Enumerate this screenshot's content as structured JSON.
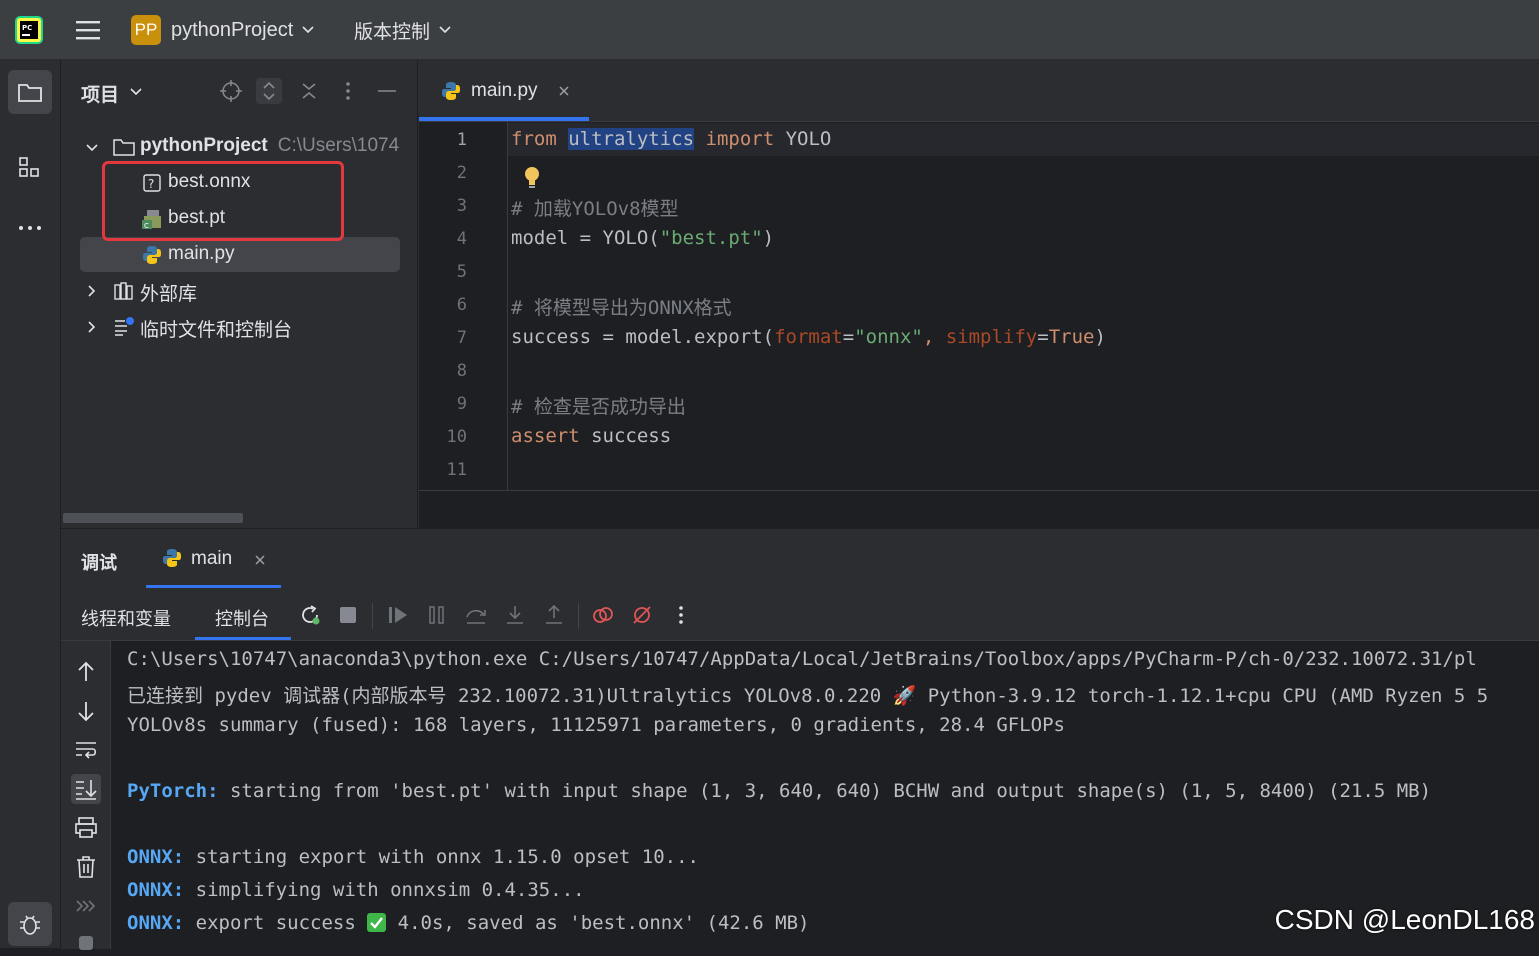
{
  "titlebar": {
    "project_badge": "PP",
    "project_name": "pythonProject",
    "vcs_label": "版本控制"
  },
  "project_panel": {
    "title": "项目",
    "tree": {
      "root_name": "pythonProject",
      "root_path": "C:\\Users\\1074",
      "files": [
        "best.onnx",
        "best.pt",
        "main.py"
      ],
      "external_libraries": "外部库",
      "scratches": "临时文件和控制台"
    }
  },
  "editor": {
    "tab_label": "main.py",
    "line_numbers": [
      "1",
      "2",
      "3",
      "4",
      "5",
      "6",
      "7",
      "8",
      "9",
      "10",
      "11"
    ],
    "code": {
      "l1_from": "from",
      "l1_module": "ultralytics",
      "l1_import": "import",
      "l1_name": "YOLO",
      "l3_comment": "# 加载YOLOv8模型",
      "l4_pre": "model = YOLO(",
      "l4_str": "\"best.pt\"",
      "l4_post": ")",
      "l6_comment": "# 将模型导出为ONNX格式",
      "l7_pre": "success = model.export(",
      "l7_p1": "format",
      "l7_eq1": "=",
      "l7_v1": "\"onnx\"",
      "l7_comma": ", ",
      "l7_p2": "simplify",
      "l7_eq2": "=",
      "l7_v2": "True",
      "l7_post": ")",
      "l9_comment": "# 检查是否成功导出",
      "l10_assert": "assert",
      "l10_rest": " success"
    }
  },
  "debug": {
    "title": "调试",
    "tab_label": "main",
    "tabs": {
      "threads": "线程和变量",
      "console": "控制台"
    },
    "console": {
      "line1": "C:\\Users\\10747\\anaconda3\\python.exe C:/Users/10747/AppData/Local/JetBrains/Toolbox/apps/PyCharm-P/ch-0/232.10072.31/pl",
      "line2": "已连接到 pydev 调试器(内部版本号 232.10072.31)Ultralytics YOLOv8.0.220 🚀 Python-3.9.12 torch-1.12.1+cpu CPU (AMD Ryzen 5 5",
      "line3": "YOLOv8s summary (fused): 168 layers, 11125971 parameters, 0 gradients, 28.4 GFLOPs",
      "line5_tag": "PyTorch:",
      "line5_text": " starting from 'best.pt' with input shape (1, 3, 640, 640) BCHW and output shape(s) (1, 5, 8400) (21.5 MB)",
      "onnx_tag": "ONNX:",
      "line7_text": " starting export with onnx 1.15.0 opset 10...",
      "line8_text": " simplifying with onnxsim 0.4.35...",
      "line9_pre": " export success ",
      "line9_post": " 4.0s, saved as 'best.onnx' (42.6 MB)"
    }
  },
  "watermark": "CSDN @LeonDL168",
  "colors": {
    "accent": "#3574f0",
    "highlight_box": "#e3383e",
    "keyword": "#cf8e6d",
    "string": "#6aab73"
  }
}
